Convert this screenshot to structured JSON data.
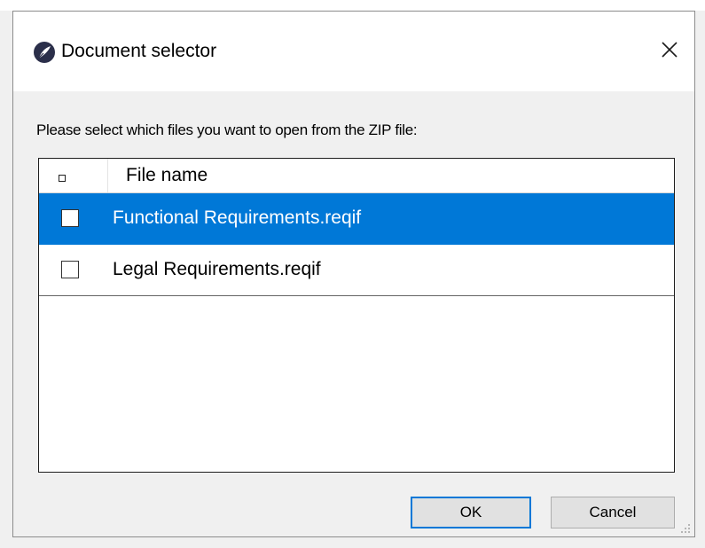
{
  "window": {
    "title": "Document selector",
    "app_icon": "quill-pen-icon",
    "close_icon": "close-icon"
  },
  "prompt": "Please select which files you want to open from the ZIP file:",
  "list": {
    "header": {
      "column_label": "File name"
    },
    "rows": [
      {
        "label": "Functional Requirements.reqif",
        "checked": false,
        "selected": true
      },
      {
        "label": "Legal Requirements.reqif",
        "checked": false,
        "selected": false
      }
    ]
  },
  "buttons": {
    "ok_label": "OK",
    "cancel_label": "Cancel"
  },
  "colors": {
    "selection": "#0078d7",
    "dialog_bg": "#f0f0f0",
    "default_button_border": "#0078d7"
  }
}
